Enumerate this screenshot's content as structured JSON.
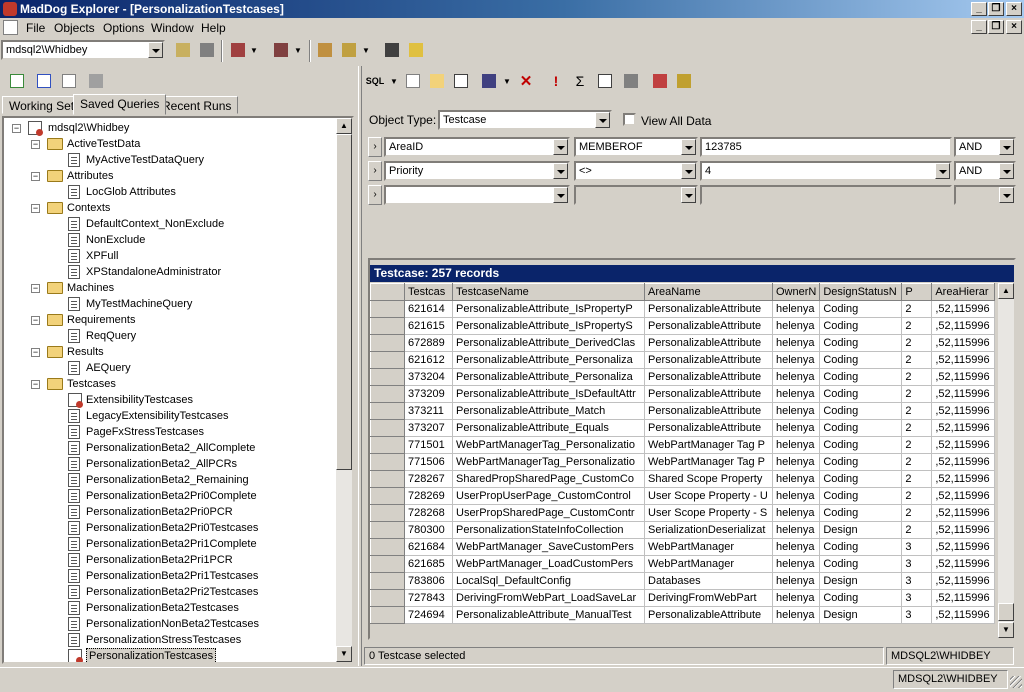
{
  "window": {
    "app_title": "MadDog Explorer - [PersonalizationTestcases]"
  },
  "menu": [
    "File",
    "Objects",
    "Options",
    "Window",
    "Help"
  ],
  "toolbar": {
    "server_combo": "mdsql2\\Whidbey"
  },
  "left_panel": {
    "tabs": [
      "Working Set",
      "Saved Queries",
      "Recent Runs"
    ],
    "active_tab": 1,
    "tree": {
      "root": "mdsql2\\Whidbey",
      "folders": [
        {
          "name": "ActiveTestData",
          "items": [
            "MyActiveTestDataQuery"
          ]
        },
        {
          "name": "Attributes",
          "items": [
            "LocGlob Attributes"
          ]
        },
        {
          "name": "Contexts",
          "items": [
            "DefaultContext_NonExclude",
            "NonExclude",
            "XPFull",
            "XPStandaloneAdministrator"
          ]
        },
        {
          "name": "Machines",
          "items": [
            "MyTestMachineQuery"
          ]
        },
        {
          "name": "Requirements",
          "items": [
            "ReqQuery"
          ]
        },
        {
          "name": "Results",
          "items": [
            "AEQuery"
          ]
        },
        {
          "name": "Testcases",
          "items": [
            "ExtensibilityTestcases",
            "LegacyExtensibilityTestcases",
            "PageFxStressTestcases",
            "PersonalizationBeta2_AllComplete",
            "PersonalizationBeta2_AllPCRs",
            "PersonalizationBeta2_Remaining",
            "PersonalizationBeta2Pri0Complete",
            "PersonalizationBeta2Pri0PCR",
            "PersonalizationBeta2Pri0Testcases",
            "PersonalizationBeta2Pri1Complete",
            "PersonalizationBeta2Pri1PCR",
            "PersonalizationBeta2Pri1Testcases",
            "PersonalizationBeta2Pri2Testcases",
            "PersonalizationBeta2Testcases",
            "PersonalizationNonBeta2Testcases",
            "PersonalizationStressTestcases",
            "PersonalizationTestcases"
          ]
        }
      ],
      "selected": "PersonalizationTestcases"
    }
  },
  "query": {
    "object_type_label": "Object Type:",
    "object_type_value": "Testcase",
    "view_all_label": "View All Data",
    "view_all_checked": false,
    "filters": [
      {
        "field": "AreaID",
        "op": "MEMBEROF",
        "value": "123785",
        "conj": "AND"
      },
      {
        "field": "Priority",
        "op": "<>",
        "value": "4",
        "conj": "AND"
      },
      {
        "field": "",
        "op": "",
        "value": "",
        "conj": ""
      }
    ]
  },
  "grid": {
    "caption": "Testcase: 257 records",
    "columns": [
      "Testcas",
      "TestcaseName",
      "AreaName",
      "OwnerN",
      "DesignStatusN",
      "P",
      "AreaHierar"
    ],
    "rows": [
      [
        "621614",
        "PersonalizableAttribute_IsPropertyP",
        "PersonalizableAttribute",
        "helenya",
        "Coding",
        "2",
        ",52,115996"
      ],
      [
        "621615",
        "PersonalizableAttribute_IsPropertyS",
        "PersonalizableAttribute",
        "helenya",
        "Coding",
        "2",
        ",52,115996"
      ],
      [
        "672889",
        "PersonalizableAttribute_DerivedClas",
        "PersonalizableAttribute",
        "helenya",
        "Coding",
        "2",
        ",52,115996"
      ],
      [
        "621612",
        "PersonalizableAttribute_Personaliza",
        "PersonalizableAttribute",
        "helenya",
        "Coding",
        "2",
        ",52,115996"
      ],
      [
        "373204",
        "PersonalizableAttribute_Personaliza",
        "PersonalizableAttribute",
        "helenya",
        "Coding",
        "2",
        ",52,115996"
      ],
      [
        "373209",
        "PersonalizableAttribute_IsDefaultAttr",
        "PersonalizableAttribute",
        "helenya",
        "Coding",
        "2",
        ",52,115996"
      ],
      [
        "373211",
        "PersonalizableAttribute_Match",
        "PersonalizableAttribute",
        "helenya",
        "Coding",
        "2",
        ",52,115996"
      ],
      [
        "373207",
        "PersonalizableAttribute_Equals",
        "PersonalizableAttribute",
        "helenya",
        "Coding",
        "2",
        ",52,115996"
      ],
      [
        "771501",
        "WebPartManagerTag_Personalizatio",
        "WebPartManager Tag P",
        "helenya",
        "Coding",
        "2",
        ",52,115996"
      ],
      [
        "771506",
        "WebPartManagerTag_Personalizatio",
        "WebPartManager Tag P",
        "helenya",
        "Coding",
        "2",
        ",52,115996"
      ],
      [
        "728267",
        "SharedPropSharedPage_CustomCo",
        "Shared Scope Property",
        "helenya",
        "Coding",
        "2",
        ",52,115996"
      ],
      [
        "728269",
        "UserPropUserPage_CustomControl",
        "User Scope Property - U",
        "helenya",
        "Coding",
        "2",
        ",52,115996"
      ],
      [
        "728268",
        "UserPropSharedPage_CustomContr",
        "User Scope Property - S",
        "helenya",
        "Coding",
        "2",
        ",52,115996"
      ],
      [
        "780300",
        "PersonalizationStateInfoCollection",
        "SerializationDeserializat",
        "helenya",
        "Design",
        "2",
        ",52,115996"
      ],
      [
        "621684",
        "WebPartManager_SaveCustomPers",
        "WebPartManager",
        "helenya",
        "Coding",
        "3",
        ",52,115996"
      ],
      [
        "621685",
        "WebPartManager_LoadCustomPers",
        "WebPartManager",
        "helenya",
        "Coding",
        "3",
        ",52,115996"
      ],
      [
        "783806",
        "LocalSql_DefaultConfig",
        "Databases",
        "helenya",
        "Design",
        "3",
        ",52,115996"
      ],
      [
        "727843",
        "DerivingFromWebPart_LoadSaveLar",
        "DerivingFromWebPart",
        "helenya",
        "Coding",
        "3",
        ",52,115996"
      ],
      [
        "724694",
        "PersonalizableAttribute_ManualTest",
        "PersonalizableAttribute",
        "helenya",
        "Design",
        "3",
        ",52,115996"
      ]
    ]
  },
  "status": {
    "selection_text": "0 Testcase selected",
    "server_inner": "MDSQL2\\WHIDBEY",
    "server_outer": "MDSQL2\\WHIDBEY"
  },
  "colors": {
    "title_gradient_start": "#0a246a",
    "face": "#d4d0c8",
    "caption_bg": "#0a246a"
  }
}
